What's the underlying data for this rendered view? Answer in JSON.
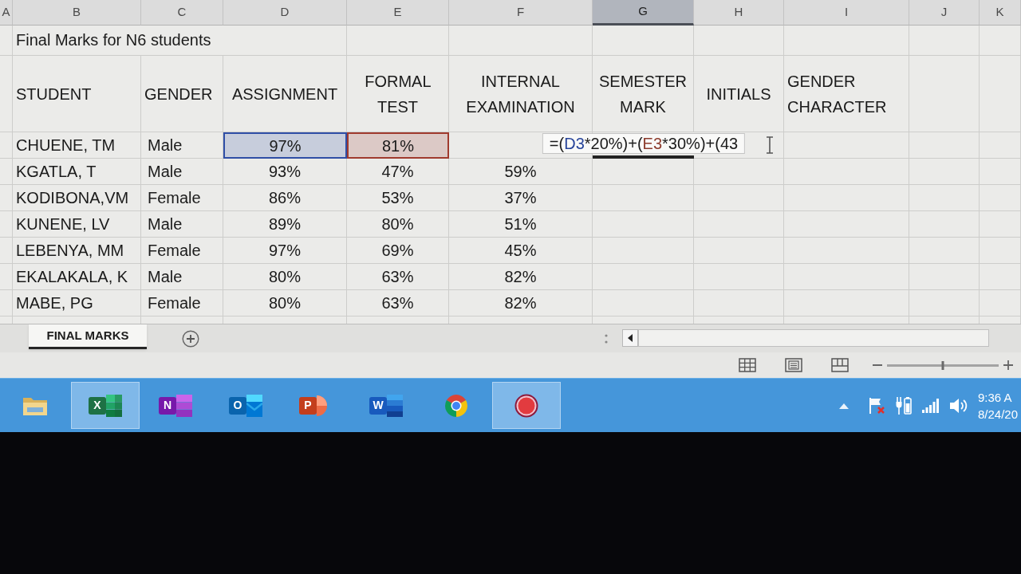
{
  "columns": [
    {
      "letter": "A",
      "selected": false
    },
    {
      "letter": "B",
      "selected": false
    },
    {
      "letter": "C",
      "selected": false
    },
    {
      "letter": "D",
      "selected": false
    },
    {
      "letter": "E",
      "selected": false
    },
    {
      "letter": "F",
      "selected": false
    },
    {
      "letter": "G",
      "selected": true
    },
    {
      "letter": "H",
      "selected": false
    },
    {
      "letter": "I",
      "selected": false
    },
    {
      "letter": "J",
      "selected": false
    },
    {
      "letter": "K",
      "selected": false
    }
  ],
  "title": "Final Marks for N6 students",
  "headers": [
    "STUDENT",
    "GENDER",
    "ASSIGNMENT",
    "FORMAL TEST",
    "INTERNAL EXAMINATION",
    "SEMESTER MARK",
    "INITIALS",
    "GENDER CHARACTER"
  ],
  "rows": [
    {
      "student": "CHUENE, TM",
      "gender": "Male",
      "assignment": "97%",
      "formal_test": "81%",
      "assignment_highlight": {
        "color": "#2f4ea6"
      },
      "formal_test_highlight": {
        "color": "#a03a2e"
      },
      "semester_mark_formula": [
        {
          "text": "=("
        },
        {
          "text": "D3",
          "color": "#27449a"
        },
        {
          "text": "*20%)+("
        },
        {
          "text": "E3",
          "color": "#8c3a2c"
        },
        {
          "text": "*30%)+(43"
        }
      ]
    },
    {
      "student": "KGATLA, T",
      "gender": "Male",
      "assignment": "93%",
      "formal_test": "47%",
      "internal_examination": "59%"
    },
    {
      "student": "KODIBONA,VM",
      "gender": "Female",
      "assignment": "86%",
      "formal_test": "53%",
      "internal_examination": "37%"
    },
    {
      "student": "KUNENE, LV",
      "gender": "Male",
      "assignment": "89%",
      "formal_test": "80%",
      "internal_examination": "51%"
    },
    {
      "student": "LEBENYA, MM",
      "gender": "Female",
      "assignment": "97%",
      "formal_test": "69%",
      "internal_examination": "45%"
    },
    {
      "student": "EKALAKALA, K",
      "gender": "Male",
      "assignment": "80%",
      "formal_test": "63%",
      "internal_examination": "82%"
    },
    {
      "student": "MABE, PG",
      "gender": "Female",
      "assignment": "80%",
      "formal_test": "63%",
      "internal_examination": "82%"
    }
  ],
  "sheets": [
    {
      "name": "FINAL MARKS",
      "selected": true
    }
  ],
  "status_bar": {
    "zoom": {
      "level": 0.5
    }
  },
  "taskbar": {
    "apps": [
      {
        "kind": "folder",
        "active": false
      },
      {
        "kind": "spreadsheet",
        "letter": "X",
        "active": true
      },
      {
        "kind": "notebook",
        "letter": "N",
        "active": false
      },
      {
        "kind": "mail",
        "letter": "O",
        "active": false
      },
      {
        "kind": "slides",
        "letter": "P",
        "active": false
      },
      {
        "kind": "document",
        "letter": "W",
        "active": false
      },
      {
        "kind": "browser",
        "active": false
      },
      {
        "kind": "recorder",
        "active": true
      }
    ],
    "clock": {
      "time": "9:36 A",
      "date": "8/24/20"
    }
  }
}
